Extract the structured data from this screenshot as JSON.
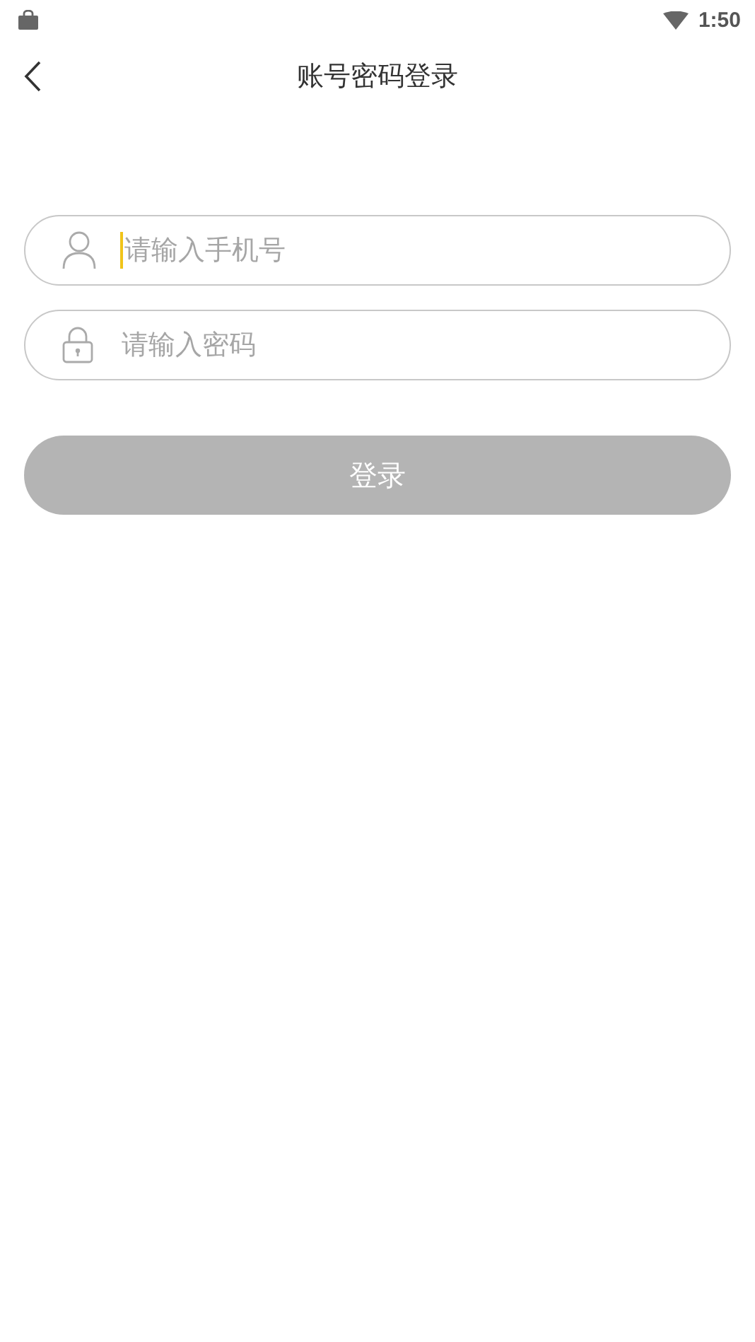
{
  "status_bar": {
    "time": "1:50"
  },
  "header": {
    "title": "账号密码登录"
  },
  "fields": [
    {
      "kind": "phone",
      "placeholder": "请输入手机号",
      "focused": true
    },
    {
      "kind": "password",
      "placeholder": "请输入密码",
      "focused": false
    }
  ],
  "login_button": {
    "label": "登录",
    "disabled": true
  }
}
